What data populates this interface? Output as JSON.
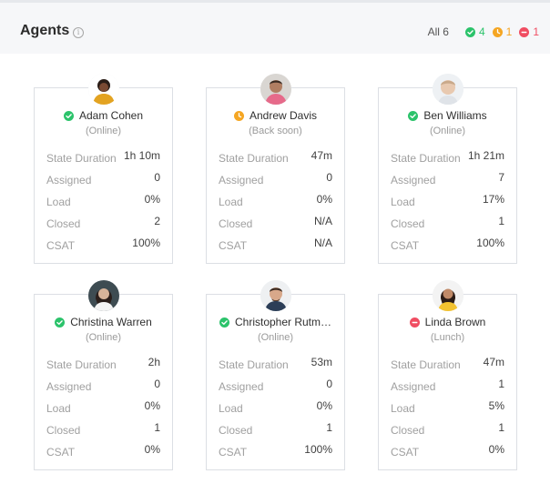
{
  "header": {
    "title": "Agents",
    "info_icon": "info-icon",
    "summary": {
      "all_label": "All 6",
      "online": {
        "count": "4",
        "icon": "check-circle-icon",
        "color": "#2cc36b"
      },
      "away": {
        "count": "1",
        "icon": "clock-icon",
        "color": "#f5a623"
      },
      "busy": {
        "count": "1",
        "icon": "minus-circle-icon",
        "color": "#f04d62"
      }
    }
  },
  "agents": [
    {
      "name": "Adam Cohen",
      "status_text": "(Online)",
      "status": "online",
      "stats": {
        "state_duration": "1h 10m",
        "assigned": "0",
        "load": "0%",
        "closed": "2",
        "csat": "100%"
      }
    },
    {
      "name": "Andrew Davis",
      "status_text": "(Back soon)",
      "status": "away",
      "stats": {
        "state_duration": "47m",
        "assigned": "0",
        "load": "0%",
        "closed": "N/A",
        "csat": "N/A"
      }
    },
    {
      "name": "Ben Williams",
      "status_text": "(Online)",
      "status": "online",
      "stats": {
        "state_duration": "1h 21m",
        "assigned": "7",
        "load": "17%",
        "closed": "1",
        "csat": "100%"
      }
    },
    {
      "name": "Christina Warren",
      "status_text": "(Online)",
      "status": "online",
      "stats": {
        "state_duration": "2h",
        "assigned": "0",
        "load": "0%",
        "closed": "1",
        "csat": "0%"
      }
    },
    {
      "name": "Christopher Rutm…",
      "status_text": "(Online)",
      "status": "online",
      "stats": {
        "state_duration": "53m",
        "assigned": "0",
        "load": "0%",
        "closed": "1",
        "csat": "100%"
      }
    },
    {
      "name": "Linda Brown",
      "status_text": "(Lunch)",
      "status": "busy",
      "stats": {
        "state_duration": "47m",
        "assigned": "1",
        "load": "5%",
        "closed": "1",
        "csat": "0%"
      }
    }
  ],
  "labels": {
    "state_duration": "State Duration",
    "assigned": "Assigned",
    "load": "Load",
    "closed": "Closed",
    "csat": "CSAT"
  }
}
